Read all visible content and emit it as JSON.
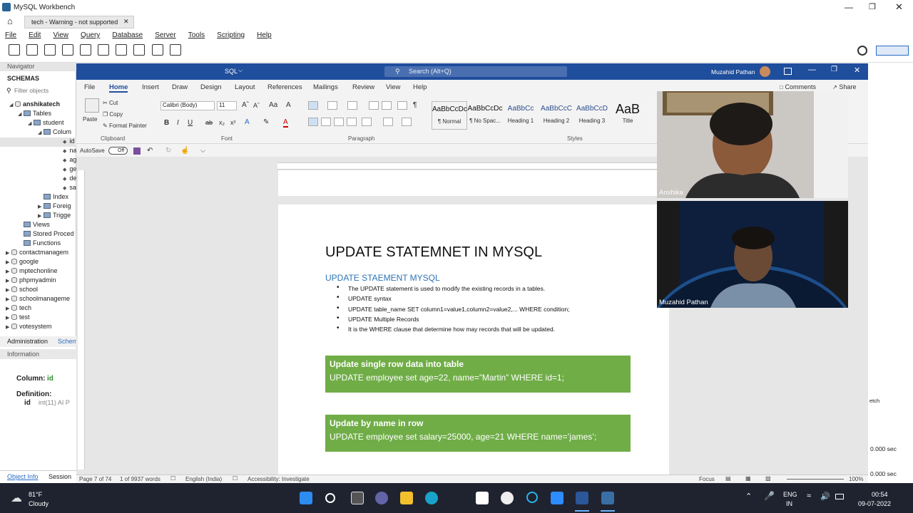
{
  "workbench": {
    "title": "MySQL Workbench",
    "tab": "tech - Warning - not supported",
    "menu": [
      "File",
      "Edit",
      "View",
      "Query",
      "Database",
      "Server",
      "Tools",
      "Scripting",
      "Help"
    ],
    "navigator_label": "Navigator",
    "schemas_label": "SCHEMAS",
    "filter_placeholder": "Filter objects",
    "tree": [
      {
        "label": "anshikatech",
        "bold": true
      },
      {
        "label": "Tables"
      },
      {
        "label": "student"
      },
      {
        "label": "Colum"
      },
      {
        "label": "id"
      },
      {
        "label": "na"
      },
      {
        "label": "ag"
      },
      {
        "label": "ge"
      },
      {
        "label": "de"
      },
      {
        "label": "sa"
      },
      {
        "label": "Index"
      },
      {
        "label": "Foreig"
      },
      {
        "label": "Trigge"
      },
      {
        "label": "Views"
      },
      {
        "label": "Stored Proced"
      },
      {
        "label": "Functions"
      },
      {
        "label": "contactmanagem"
      },
      {
        "label": "google"
      },
      {
        "label": "mptechonline"
      },
      {
        "label": "phpmyadmin"
      },
      {
        "label": "school"
      },
      {
        "label": "schoolmanageme"
      },
      {
        "label": "tech"
      },
      {
        "label": "test"
      },
      {
        "label": "votesystem"
      }
    ],
    "admin_tab": "Administration",
    "schema_tab": "Schem",
    "information_label": "Information",
    "column_label": "Column:",
    "column_value": "id",
    "definition_label": "Definition:",
    "def_name": "id",
    "def_type": "int(11) AI P",
    "object_info": "Object Info",
    "session": "Session",
    "right_values": [
      "0.000 sec",
      "0.000 sec"
    ],
    "right_snippet": "etch"
  },
  "word": {
    "sql_label": "SQL",
    "search": "Search (Alt+Q)",
    "user": "Muzahid Pathan",
    "tabs": [
      "File",
      "Home",
      "Insert",
      "Draw",
      "Design",
      "Layout",
      "References",
      "Mailings",
      "Review",
      "View",
      "Help"
    ],
    "comments": "Comments",
    "share": "Share",
    "clipboard": {
      "paste": "Paste",
      "cut": "Cut",
      "copy": "Copy",
      "format_painter": "Format Painter",
      "label": "Clipboard"
    },
    "font": {
      "name": "Calibri (Body)",
      "size": "11",
      "label": "Font"
    },
    "paragraph_label": "Paragraph",
    "styles_label": "Styles",
    "styles": [
      {
        "sample": "AaBbCcDc",
        "name": "¶ Normal"
      },
      {
        "sample": "AaBbCcDc",
        "name": "¶ No Spac..."
      },
      {
        "sample": "AaBbCc",
        "name": "Heading 1"
      },
      {
        "sample": "AaBbCcC",
        "name": "Heading 2"
      },
      {
        "sample": "AaBbCcD",
        "name": "Heading 3"
      },
      {
        "sample": "AaB",
        "name": "Title"
      },
      {
        "sample": "Aa",
        "name": "S"
      }
    ],
    "autosave": "AutoSave",
    "autosave_state": "Off",
    "doc": {
      "title": "UPDATE STATEMNET IN MYSQL",
      "subtitle": "UPDATE STAEMENT MYSQL",
      "bullets": [
        "The UPDATE statement is used to modify the existing records in a tables.",
        "UPDATE syntax",
        "UPDATE table_name SET column1=value1,column2=value2,... WHERE condition;",
        "UPDATE Multiple Records",
        "It is the WHERE clause that determine how may records that will be updated."
      ],
      "box1": {
        "heading": "Update single row data into table",
        "code": "UPDATE employee set age=22, name=”Martin” WHERE id=1;"
      },
      "box2": {
        "heading": "Update by name in row",
        "code": "UPDATE employee set salary=25000, age=21 WHERE name=’james’;"
      }
    },
    "status": {
      "page": "Page 7 of 74",
      "words": "1 of 9937 words",
      "lang": "English (India)",
      "accessibility": "Accessibility: Investigate",
      "focus": "Focus",
      "zoom": "100%"
    }
  },
  "video": {
    "person1": "Anshika",
    "person2": "Muzahid Pathan"
  },
  "taskbar": {
    "temp": "81°F",
    "weather": "Cloudy",
    "lang1": "ENG",
    "lang2": "IN",
    "time": "00:54",
    "date": "09-07-2022"
  },
  "colors": {
    "word_blue": "#1f4e9c",
    "green_box": "#70ad47",
    "heading_blue": "#2e74b5",
    "taskbar": "#1f2330"
  }
}
